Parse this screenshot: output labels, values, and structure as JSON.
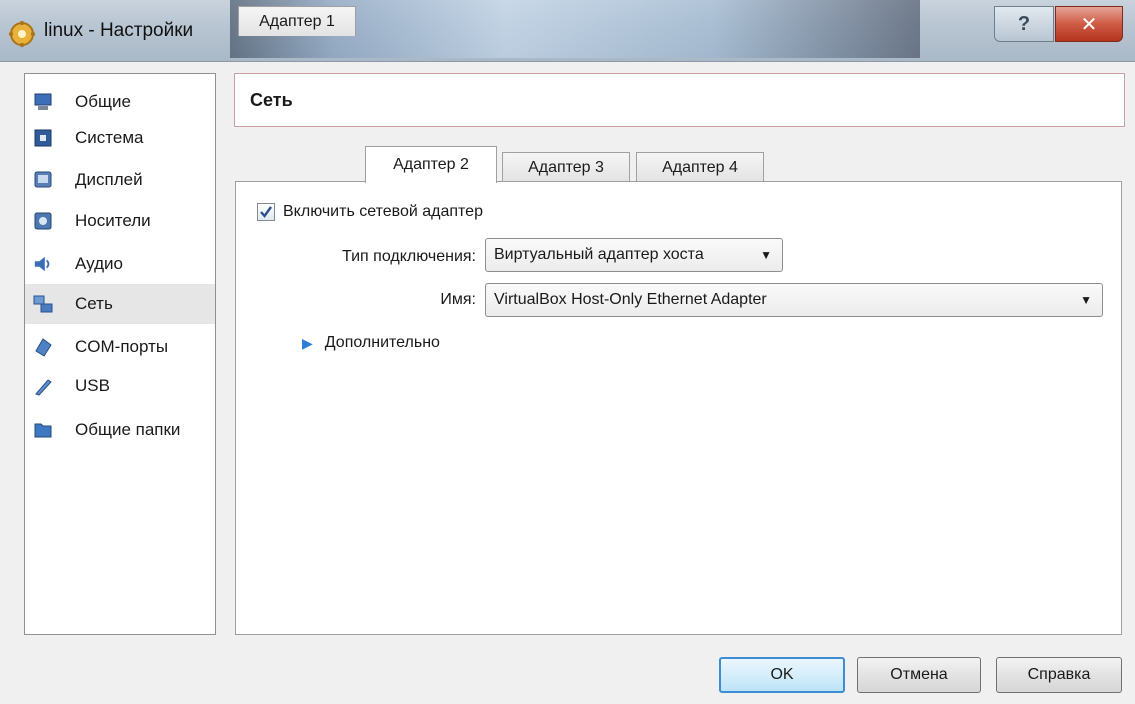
{
  "window": {
    "title": "linux - Настройки",
    "help_glyph": "?",
    "close_glyph": "✕"
  },
  "sidebar": {
    "items": [
      {
        "label": "Общие",
        "icon": "monitor-icon"
      },
      {
        "label": "Система",
        "icon": "chip-icon"
      },
      {
        "label": "Дисплей",
        "icon": "display-icon"
      },
      {
        "label": "Носители",
        "icon": "disk-icon"
      },
      {
        "label": "Аудио",
        "icon": "speaker-icon"
      },
      {
        "label": "Сеть",
        "icon": "network-icon",
        "active": true
      },
      {
        "label": "COM-порты",
        "icon": "serial-port-icon"
      },
      {
        "label": "USB",
        "icon": "usb-icon"
      },
      {
        "label": "Общие папки",
        "icon": "folder-icon"
      }
    ]
  },
  "section": {
    "title": "Сеть"
  },
  "tabs": [
    {
      "label": "Адаптер 1",
      "active": false
    },
    {
      "label": "Адаптер 2",
      "active": true
    },
    {
      "label": "Адаптер 3",
      "active": false
    },
    {
      "label": "Адаптер 4",
      "active": false
    }
  ],
  "adapter": {
    "enable_label": "Включить сетевой адаптер",
    "enabled": true,
    "attached_label": "Тип подключения:",
    "attached_value": "Виртуальный адаптер хоста",
    "name_label": "Имя:",
    "name_value": "VirtualBox Host-Only Ethernet Adapter",
    "advanced_label": "Дополнительно"
  },
  "buttons": {
    "ok": "OK",
    "cancel": "Отмена",
    "help": "Справка"
  },
  "colors": {
    "accent": "#3c8dd2",
    "expander": "#2b7fd6"
  }
}
